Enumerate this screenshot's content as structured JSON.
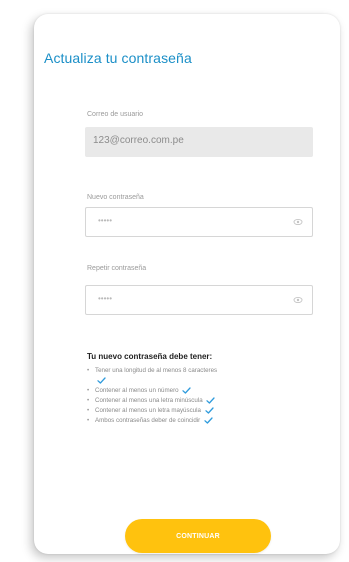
{
  "form": {
    "title": "Actualiza tu contraseña",
    "email_label": "Correo de usuario",
    "email_value": "123@correo.com.pe",
    "new_password_label": "Nuevo contraseña",
    "new_password_mask": "•••••",
    "repeat_password_label": "Repetir contraseña",
    "repeat_password_mask": "•••••",
    "requirements_title": "Tu nuevo contraseña debe tener:",
    "requirements": [
      "Tener una longitud de al menos 8 caracteres",
      "Contener al menos un número",
      "Contener al menos una letra minúscula",
      "Contener al menos un letra mayúscula",
      "Ambos contraseñas deber de coincidir"
    ],
    "continue_label": "CONTINUAR"
  },
  "colors": {
    "accent": "#1b8fc7",
    "button": "#ffc20e",
    "check": "#2f9bdc"
  },
  "icons": {
    "password_toggle": "eye-icon",
    "requirement_met": "checkmark-icon"
  }
}
